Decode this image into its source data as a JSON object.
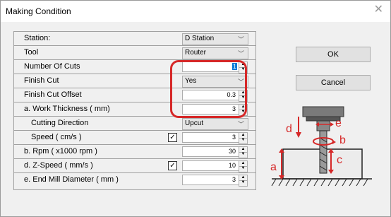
{
  "window": {
    "title": "Making Condition",
    "close_glyph": "✕"
  },
  "fields": [
    {
      "label": "Station:",
      "control": "combo",
      "value": "D Station"
    },
    {
      "label": "Tool",
      "control": "combo",
      "value": "Router"
    },
    {
      "label": "Number Of Cuts",
      "control": "spin",
      "value": "1",
      "selected": true
    },
    {
      "label": "Finish Cut",
      "control": "combo",
      "value": "Yes"
    },
    {
      "label": "Finish Cut Offset",
      "control": "spin",
      "value": "0.3"
    },
    {
      "label": "a. Work Thickness ( mm)",
      "control": "spin",
      "value": "3"
    },
    {
      "label": "Cutting Direction",
      "control": "combo",
      "value": "Upcut"
    },
    {
      "label": "Speed ( cm/s )",
      "control": "spin",
      "value": "3",
      "checked": true
    },
    {
      "label": "b. Rpm ( x1000  rpm )",
      "control": "spin",
      "value": "30"
    },
    {
      "label": "d. Z-Speed ( mm/s )",
      "control": "spin",
      "value": "10",
      "checked": true
    },
    {
      "label": "e. End Mill Diameter ( mm )",
      "control": "spin",
      "value": "3"
    }
  ],
  "buttons": {
    "ok": "OK",
    "cancel": "Cancel"
  },
  "illustration": {
    "labels": {
      "a": "a",
      "b": "b",
      "c": "c",
      "d": "d",
      "e": "e"
    },
    "accent": "#d62828"
  },
  "colors": {
    "highlight": "#d62828",
    "selection": "#0078d7"
  }
}
